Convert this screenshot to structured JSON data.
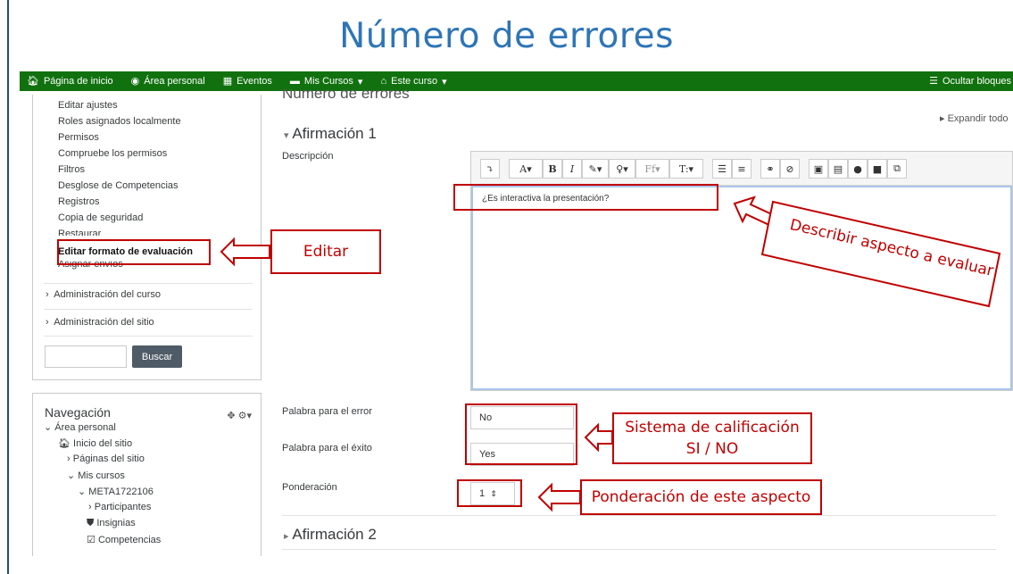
{
  "slide": {
    "title": "Número de errores"
  },
  "navbar": {
    "home": "Página de inicio",
    "dashboard": "Área personal",
    "events": "Eventos",
    "my_courses": "Mis Cursos",
    "this_course": "Este curso",
    "hide_blocks": "Ocultar bloques"
  },
  "page": {
    "partial_title": "Número de errores",
    "expand_all": "Expandir todo"
  },
  "admin": {
    "links": [
      "Editar ajustes",
      "Roles asignados localmente",
      "Permisos",
      "Compruebe los permisos",
      "Filtros",
      "Desglose de Competencias",
      "Registros",
      "Copia de seguridad",
      "Restaurar",
      "Editar formato de evaluación",
      "Asignar envíos"
    ],
    "course_admin": "Administración del curso",
    "site_admin": "Administración del sitio",
    "search_button": "Buscar"
  },
  "navigation": {
    "title": "Navegación",
    "items": [
      "Área personal",
      "Inicio del sitio",
      "Páginas del sitio",
      "Mis cursos",
      "META1722106",
      "Participantes",
      "Insignias",
      "Competencias"
    ]
  },
  "form": {
    "section1": "Afirmación 1",
    "description_label": "Descripción",
    "description_text": "¿Es interactiva la presentación?",
    "error_word_label": "Palabra para el error",
    "error_word_value": "No",
    "success_word_label": "Palabra para el éxito",
    "success_word_value": "Yes",
    "weight_label": "Ponderación",
    "weight_value": "1",
    "section2": "Afirmación 2"
  },
  "annotations": {
    "edit": "Editar",
    "describe": "Describir aspecto a evaluar",
    "grading_line1": "Sistema de calificación",
    "grading_line2": "SI / NO",
    "weight": "Ponderación de este aspecto"
  },
  "colors": {
    "navbar": "#11710f",
    "annotation": "#c00000",
    "title": "#2e75b6"
  }
}
